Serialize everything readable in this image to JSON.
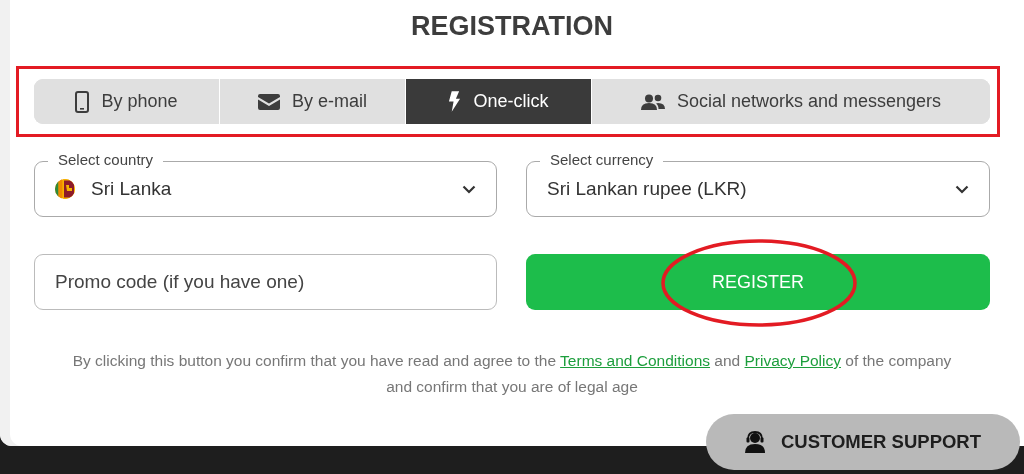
{
  "title": "REGISTRATION",
  "tabs": [
    {
      "label": "By phone",
      "kind": "phone",
      "selected": false
    },
    {
      "label": "By e-mail",
      "kind": "mail",
      "selected": false
    },
    {
      "label": "One-click",
      "kind": "bolt",
      "selected": true
    },
    {
      "label": "Social networks and messengers",
      "kind": "people",
      "selected": false
    }
  ],
  "country": {
    "label": "Select country",
    "value": "Sri Lanka"
  },
  "currency": {
    "label": "Select currency",
    "value": "Sri Lankan rupee (LKR)"
  },
  "promo": {
    "placeholder": "Promo code (if you have one)"
  },
  "register_button": "REGISTER",
  "legal": [
    {
      "kind": "text",
      "text": "By clicking this button you confirm that you have read and agree to the "
    },
    {
      "kind": "link",
      "text": "Terms and Conditions"
    },
    {
      "kind": "text",
      "text": " and "
    },
    {
      "kind": "link",
      "text": "Privacy Policy"
    },
    {
      "kind": "text",
      "text": " of the company and confirm that you are of legal age"
    }
  ],
  "support_button": "CUSTOMER SUPPORT"
}
